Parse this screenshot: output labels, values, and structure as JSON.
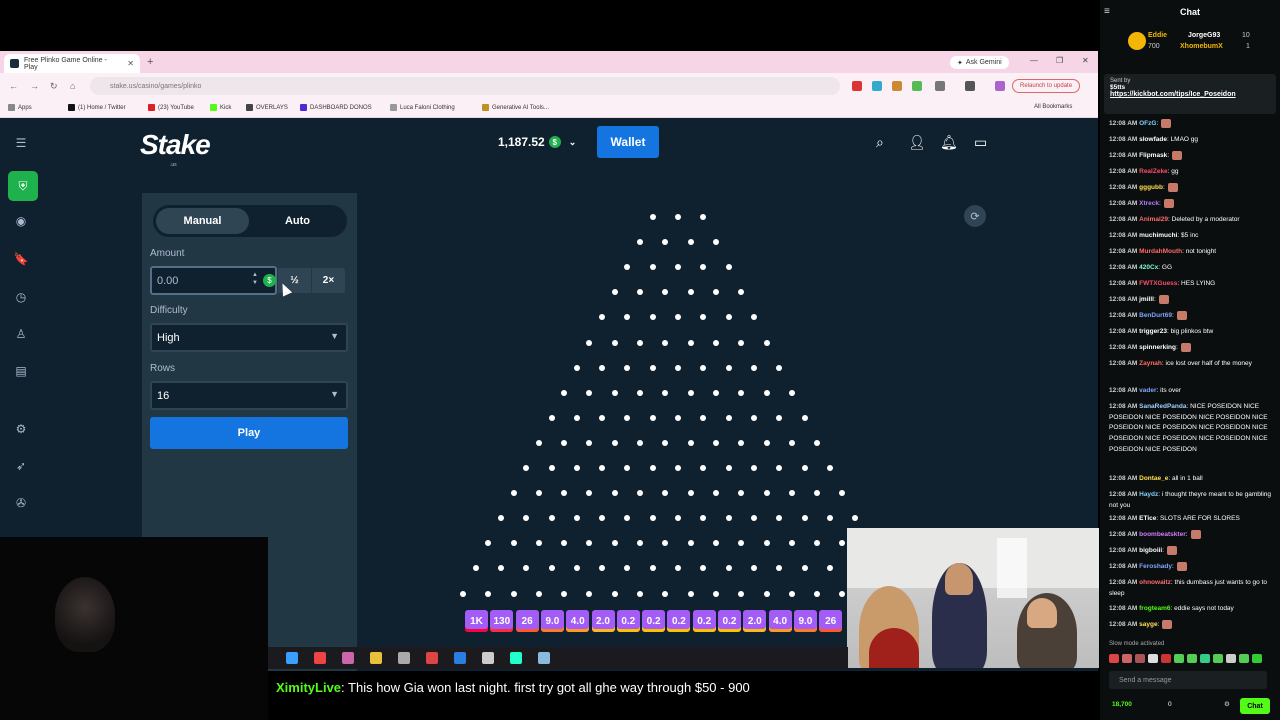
{
  "browser": {
    "tab_title": "Free Plinko Game Online - Play",
    "new_tab": "+",
    "gemini_label": "Ask Gemini",
    "url": "stake.us/casino/games/plinko",
    "relaunch": "Relaunch to update",
    "bookmarks": [
      {
        "label": "Apps",
        "color": "#888888"
      },
      {
        "label": "(1) Home / Twitter",
        "color": "#111111"
      },
      {
        "label": "(23) YouTube",
        "color": "#e02020"
      },
      {
        "label": "Kick",
        "color": "#53fc18"
      },
      {
        "label": "OVERLAYS",
        "color": "#444444"
      },
      {
        "label": "DASHBOARD DONOS",
        "color": "#4a2bd6"
      },
      {
        "label": "Luca Faloni Clothing",
        "color": "#999999"
      },
      {
        "label": "Generative AI Tools...",
        "color": "#c09020"
      }
    ],
    "all_bookmarks": "All Bookmarks"
  },
  "stake": {
    "logo": "Stake",
    "logo_sub": ".us",
    "balance": "1,187.52",
    "coin_symbol": "$",
    "wallet": "Wallet",
    "modes": [
      "Manual",
      "Auto"
    ],
    "amount_label": "Amount",
    "amount_placeholder": "0.00",
    "half": "½",
    "double": "2×",
    "difficulty_label": "Difficulty",
    "difficulty_value": "High",
    "rows_label": "Rows",
    "rows_value": "16",
    "play": "Play",
    "peg_rows": 16,
    "buckets": [
      "1K",
      "130",
      "26",
      "9.0",
      "4.0",
      "2.0",
      "0.2",
      "0.2",
      "0.2",
      "0.2",
      "0.2",
      "2.0",
      "4.0",
      "9.0",
      "26"
    ],
    "bucket_colors": [
      "#ff003f",
      "#ff2a3a",
      "#ff5530",
      "#ff7a25",
      "#ff9a1f",
      "#ffb81a",
      "#ffc000",
      "#ffc000",
      "#ffc000",
      "#ffc000",
      "#ffc000",
      "#ffb81a",
      "#ff9a1f",
      "#ff7a25",
      "#ff5530"
    ],
    "bucket_tint": "#a35cf5"
  },
  "tts": {
    "user": "XimityLive",
    "message": ": This how Gia won last night. first try got all ghe way through $50 - 900"
  },
  "chat": {
    "title": "Chat",
    "leaderboard": [
      {
        "name": "Eddie",
        "count": "700"
      },
      {
        "name": "JorgeG93",
        "count": "10"
      },
      {
        "name": "XhomebumX",
        "count": "1"
      }
    ],
    "pinned_label": "Sent by",
    "pinned_amount": "$5tts",
    "pinned_link": "https://kickbot.com/tips/Ice_Poseidon",
    "messages": [
      {
        "time": "12:08 AM",
        "user": "OFzG",
        "color": "#7fd1ff",
        "text": ":"
      },
      {
        "time": "12:08 AM",
        "user": "slowfade",
        "color": "#ffffff",
        "text": ": LMAO gg"
      },
      {
        "time": "12:08 AM",
        "user": "Flipmask",
        "color": "#ffffff",
        "text": ":"
      },
      {
        "time": "12:08 AM",
        "user": "RealZeke",
        "color": "#ff4d6d",
        "text": ": gg"
      },
      {
        "time": "12:08 AM",
        "user": "gggubb",
        "color": "#ffe14d",
        "text": ":"
      },
      {
        "time": "12:08 AM",
        "user": "Xtreck",
        "color": "#b07cff",
        "text": ":"
      },
      {
        "time": "12:08 AM",
        "user": "Animal29",
        "color": "#ff6b6b",
        "text": ": Deleted by a moderator"
      },
      {
        "time": "12:08 AM",
        "user": "muchimuchi",
        "color": "#ffffff",
        "text": ": $5 inc"
      },
      {
        "time": "12:08 AM",
        "user": "MurdahMouth",
        "color": "#ff6b6b",
        "text": ": not tonight"
      },
      {
        "time": "12:08 AM",
        "user": "420Cx",
        "color": "#7fffd4",
        "text": ": GG"
      },
      {
        "time": "12:08 AM",
        "user": "FWTXGuess",
        "color": "#ff4d6d",
        "text": ": HES LYING"
      },
      {
        "time": "12:08 AM",
        "user": "jmilll",
        "color": "#ffffff",
        "text": ":"
      },
      {
        "time": "12:08 AM",
        "user": "BenDurt69",
        "color": "#7fa6ff",
        "text": ":"
      },
      {
        "time": "12:08 AM",
        "user": "trigger23",
        "color": "#ffffff",
        "text": ": big plinkos btw"
      },
      {
        "time": "12:08 AM",
        "user": "spinnerking",
        "color": "#ffffff",
        "text": ":"
      },
      {
        "time": "12:08 AM",
        "user": "Zaynah",
        "color": "#ff6b6b",
        "text": ": ice lost over half of the money"
      },
      {
        "time": "12:08 AM",
        "user": "vader",
        "color": "#7fa6ff",
        "text": ": its over"
      },
      {
        "time": "12:08 AM",
        "user": "SanaRedPanda",
        "color": "#9fd0ff",
        "text": ": NICE POSEIDON NICE POSEIDON NICE POSEIDON NICE POSEIDON NICE POSEIDON NICE POSEIDON NICE POSEIDON NICE POSEIDON NICE POSEIDON NICE POSEIDON NICE POSEIDON NICE POSEIDON"
      },
      {
        "time": "12:08 AM",
        "user": "Dontae_e",
        "color": "#ffe14d",
        "text": ": all in 1 ball"
      },
      {
        "time": "12:08 AM",
        "user": "Haydz",
        "color": "#7fd1ff",
        "text": ": i thought theyre meant to be gambling not you"
      },
      {
        "time": "12:08 AM",
        "user": "ETice",
        "color": "#ffffff",
        "text": ": SLOTS ARE FOR SLORES"
      },
      {
        "time": "12:08 AM",
        "user": "boombeatskter",
        "color": "#d27cff",
        "text": ":"
      },
      {
        "time": "12:08 AM",
        "user": "bigboiii",
        "color": "#ffffff",
        "text": ":"
      },
      {
        "time": "12:08 AM",
        "user": "Feroshady",
        "color": "#7fa6ff",
        "text": ":"
      },
      {
        "time": "12:08 AM",
        "user": "ohnowaitz",
        "color": "#ff6b6b",
        "text": ": this dumbass just wants to go to sleep"
      },
      {
        "time": "12:08 AM",
        "user": "frogteam6",
        "color": "#53fc18",
        "text": ": eddie says not today"
      },
      {
        "time": "12:08 AM",
        "user": "sayge",
        "color": "#ffe14d",
        "text": ":"
      }
    ],
    "slow_mode": "Slow mode activated",
    "input_placeholder": "Send a message",
    "followers": "18,700",
    "viewers": "0",
    "send": "Chat"
  }
}
